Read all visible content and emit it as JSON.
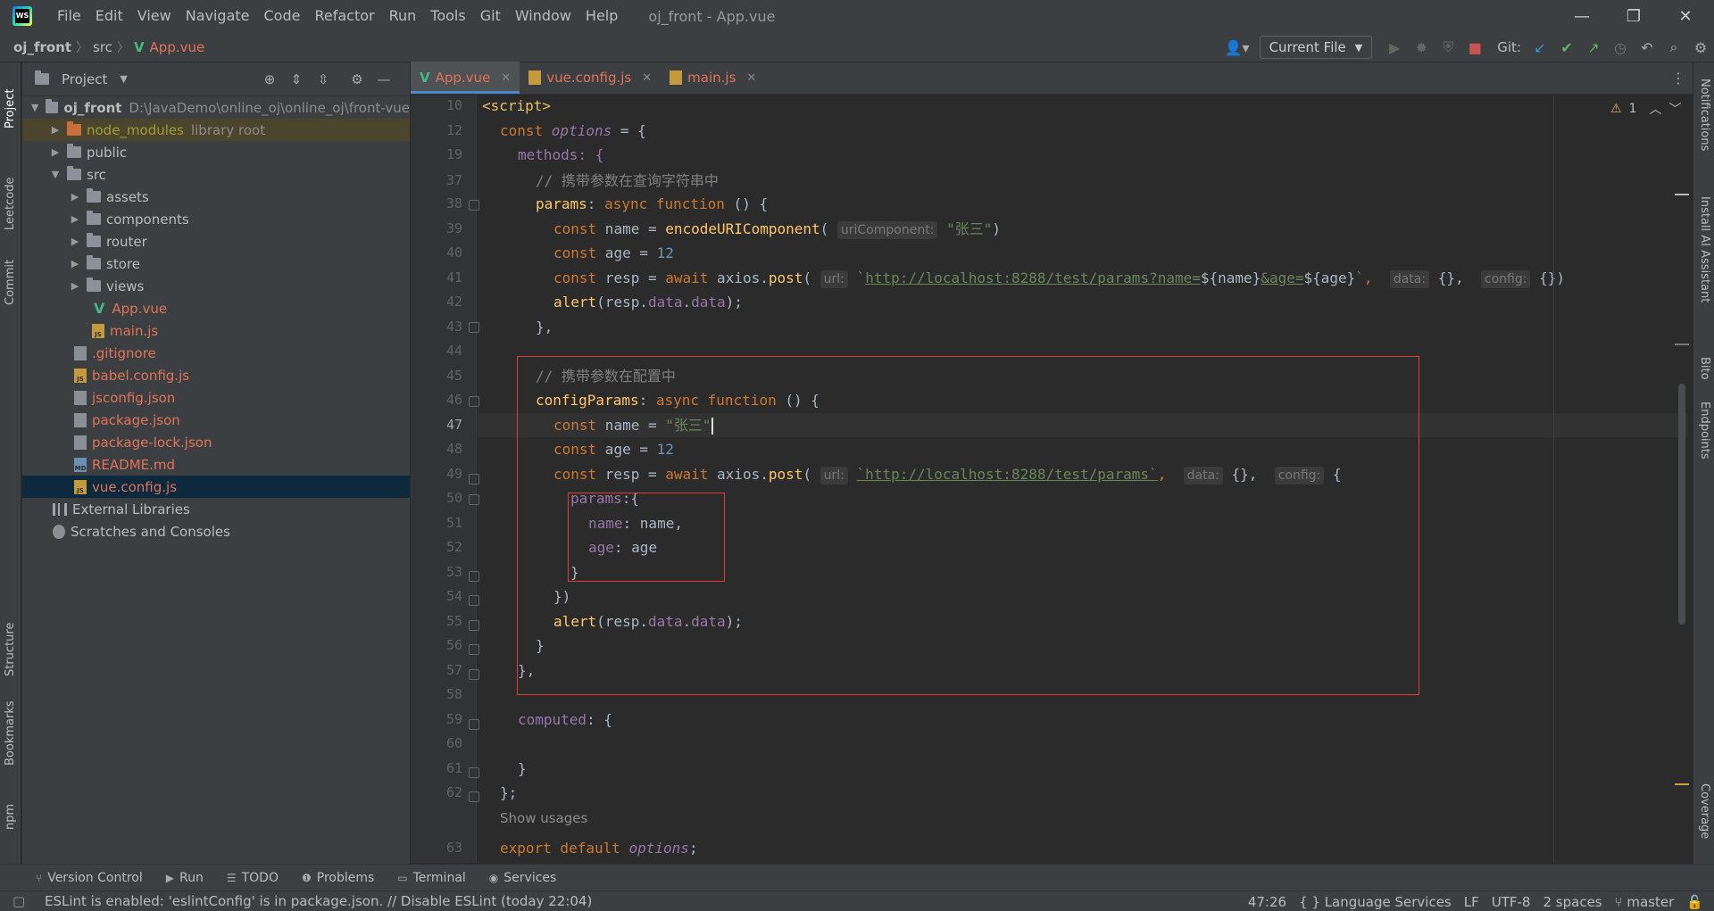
{
  "menu": [
    "File",
    "Edit",
    "View",
    "Navigate",
    "Code",
    "Refactor",
    "Run",
    "Tools",
    "Git",
    "Window",
    "Help"
  ],
  "window_title": "oj_front - App.vue",
  "breadcrumb": {
    "project": "oj_front",
    "folder": "src",
    "file": "App.vue"
  },
  "toolbar": {
    "run_config": "Current File",
    "git_label": "Git:"
  },
  "project_panel": {
    "title": "Project",
    "tree": [
      {
        "label": "oj_front",
        "extra": "D:\\JavaDemo\\online_oj\\online_oj\\front-vue",
        "type": "root"
      },
      {
        "label": "node_modules",
        "extra": "library root",
        "type": "excluded"
      },
      {
        "label": "public",
        "type": "folder"
      },
      {
        "label": "src",
        "type": "folder-open"
      },
      {
        "label": "assets",
        "type": "folder"
      },
      {
        "label": "components",
        "type": "folder"
      },
      {
        "label": "router",
        "type": "folder"
      },
      {
        "label": "store",
        "type": "folder"
      },
      {
        "label": "views",
        "type": "folder"
      },
      {
        "label": "App.vue",
        "type": "vue"
      },
      {
        "label": "main.js",
        "type": "js"
      },
      {
        "label": ".gitignore",
        "type": "file"
      },
      {
        "label": "babel.config.js",
        "type": "js"
      },
      {
        "label": "jsconfig.json",
        "type": "json"
      },
      {
        "label": "package.json",
        "type": "json"
      },
      {
        "label": "package-lock.json",
        "type": "json"
      },
      {
        "label": "README.md",
        "type": "md"
      },
      {
        "label": "vue.config.js",
        "type": "js"
      },
      {
        "label": "External Libraries",
        "type": "lib"
      },
      {
        "label": "Scratches and Consoles",
        "type": "scratch"
      }
    ]
  },
  "editor_tabs": [
    "App.vue",
    "vue.config.js",
    "main.js"
  ],
  "inspection": {
    "count": "1"
  },
  "line_numbers": [
    "10",
    "12",
    "19",
    "37",
    "38",
    "39",
    "40",
    "41",
    "42",
    "43",
    "44",
    "45",
    "46",
    "47",
    "48",
    "49",
    "50",
    "51",
    "52",
    "53",
    "54",
    "55",
    "56",
    "57",
    "58",
    "59",
    "60",
    "61",
    "62",
    "",
    "63"
  ],
  "code": {
    "l10": "<script>",
    "l12a": "const ",
    "l12b": "options",
    "l12c": " = {",
    "l19": "methods: {",
    "l37": "// 携带参数在查询字符串中",
    "l38a": "params",
    "l38b": ": ",
    "l38c": "async function",
    "l38d": " () {",
    "l39a": "const",
    "l39b": " name = ",
    "l39c": "encodeURIComponent",
    "l39d": "(",
    "l39hint": "uriComponent:",
    "l39e": "\"张三\"",
    "l39f": ")",
    "l40a": "const",
    "l40b": " age = ",
    "l40c": "12",
    "l41a": "const",
    "l41b": " resp = ",
    "l41c": "await",
    "l41d": " axios.",
    "l41e": "post",
    "l41f": "(",
    "l41hint1": "url:",
    "l41g": "`",
    "l41url": "http://localhost:8288/test/params?name=",
    "l41v1": "${name}",
    "l41url2": "&age=",
    "l41v2": "${age}",
    "l41h": "`",
    "l41i": ", ",
    "l41hint2": "data:",
    "l41j": "{}, ",
    "l41hint3": "config:",
    "l41k": "{})",
    "l42a": "alert",
    "l42b": "(resp.",
    "l42c": "data",
    "l42d": ".",
    "l42e": "data",
    "l42f": ");",
    "l43": "},",
    "l45": "// 携带参数在配置中",
    "l46a": "configParams",
    "l46b": ": ",
    "l46c": "async function",
    "l46d": " () {",
    "l47a": "const",
    "l47b": " name = ",
    "l47c": "\"张三\"",
    "l48a": "const",
    "l48b": " age = ",
    "l48c": "12",
    "l49a": "const",
    "l49b": " resp = ",
    "l49c": "await",
    "l49d": " axios.",
    "l49e": "post",
    "l49f": "(",
    "l49hint1": "url:",
    "l49url": "`http://localhost:8288/test/params`",
    "l49g": ", ",
    "l49hint2": "data:",
    "l49h": "{}, ",
    "l49hint3": "config:",
    "l49i": "{",
    "l50a": "params",
    "l50b": ":{",
    "l51a": "name",
    "l51b": ": name,",
    "l52a": "age",
    "l52b": ": age",
    "l53": "}",
    "l54": "})",
    "l55a": "alert",
    "l55b": "(resp.",
    "l55c": "data",
    "l55d": ".",
    "l55e": "data",
    "l55f": ");",
    "l56": "}",
    "l57": "},",
    "l59a": "computed",
    "l59b": ": {",
    "l61": "}",
    "l62": "};",
    "usages": "Show usages",
    "l63a": "export default ",
    "l63b": "options",
    "l63c": ";"
  },
  "left_tabs": [
    "Project",
    "Leetcode",
    "Commit",
    "Structure",
    "Bookmarks",
    "npm"
  ],
  "right_tabs": [
    "Notifications",
    "Install AI Assistant",
    "Bito",
    "Endpoints",
    "Coverage"
  ],
  "bottom_tabs": [
    "Version Control",
    "Run",
    "TODO",
    "Problems",
    "Terminal",
    "Services"
  ],
  "status": {
    "message": "ESLint is enabled: 'eslintConfig' is in package.json. // Disable ESLint (today 22:04)",
    "position": "47:26",
    "language": "Language Services",
    "line_sep": "LF",
    "encoding": "UTF-8",
    "indent": "2 spaces",
    "branch": "master"
  }
}
